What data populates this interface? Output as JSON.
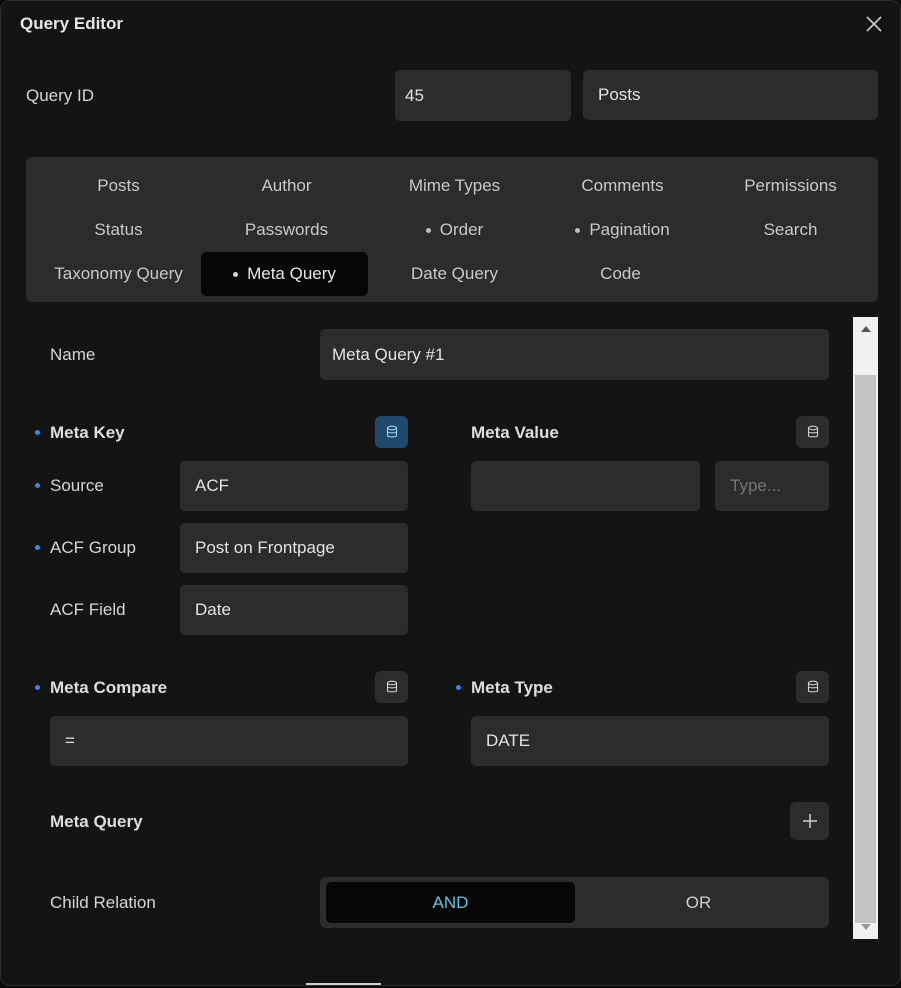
{
  "dialog": {
    "title": "Query Editor"
  },
  "query": {
    "id_label": "Query ID",
    "id_value": "45",
    "type_value": "Posts"
  },
  "tabs": [
    {
      "label": "Posts",
      "dot": false
    },
    {
      "label": "Author",
      "dot": false
    },
    {
      "label": "Mime Types",
      "dot": false
    },
    {
      "label": "Comments",
      "dot": false
    },
    {
      "label": "Permissions",
      "dot": false
    },
    {
      "label": "Status",
      "dot": false
    },
    {
      "label": "Passwords",
      "dot": false
    },
    {
      "label": "Order",
      "dot": true
    },
    {
      "label": "Pagination",
      "dot": true
    },
    {
      "label": "Search",
      "dot": false
    },
    {
      "label": "Taxonomy Query",
      "dot": false
    },
    {
      "label": "Meta Query",
      "dot": true,
      "active": true
    },
    {
      "label": "Date Query",
      "dot": false
    },
    {
      "label": "Code",
      "dot": false
    }
  ],
  "form": {
    "name_label": "Name",
    "name_value": "Meta Query #1",
    "meta_key": {
      "title": "Meta Key",
      "source_label": "Source",
      "source_value": "ACF",
      "acf_group_label": "ACF Group",
      "acf_group_value": "Post on Frontpage",
      "acf_field_label": "ACF Field",
      "acf_field_value": "Date"
    },
    "meta_value": {
      "title": "Meta Value",
      "value": "",
      "type_placeholder": "Type..."
    },
    "meta_compare": {
      "title": "Meta Compare",
      "value": "="
    },
    "meta_type": {
      "title": "Meta Type",
      "value": "DATE"
    },
    "meta_query": {
      "title": "Meta Query"
    },
    "child_relation": {
      "label": "Child Relation",
      "options": [
        "AND",
        "OR"
      ],
      "selected": "AND"
    }
  },
  "colors": {
    "accent": "#2d8cf0",
    "active_toggle_text": "#5bc8e6",
    "active_db": "#1f4a6d"
  },
  "icons": {
    "close": "close-icon",
    "database": "database-icon",
    "plus": "plus-icon"
  }
}
